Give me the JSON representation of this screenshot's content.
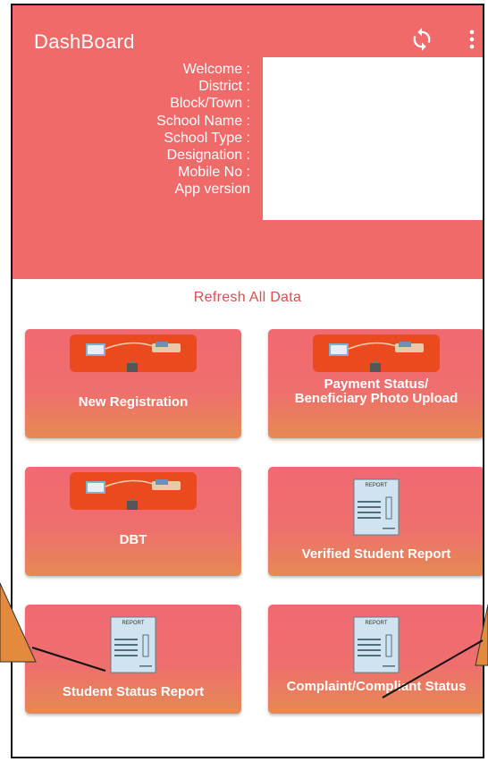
{
  "header": {
    "title": "DashBoard",
    "icons": [
      "sync-icon",
      "more-vert-icon"
    ],
    "fields": [
      "Welcome :",
      "District :",
      "Block/Town :",
      "School Name :",
      "School Type :",
      "Designation :",
      "Mobile No :",
      "App version"
    ]
  },
  "refresh_label": "Refresh All Data",
  "cards": [
    {
      "label": "New Registration",
      "icon": "money-transfer-icon"
    },
    {
      "label": "Payment Status/ Beneficiary Photo Upload",
      "icon": "money-transfer-icon"
    },
    {
      "label": "DBT",
      "icon": "money-transfer-icon"
    },
    {
      "label": "Verified Student Report",
      "icon": "report-icon"
    },
    {
      "label": "Student Status Report",
      "icon": "report-icon"
    },
    {
      "label": "Complaint/Compliant Status",
      "icon": "report-icon"
    }
  ],
  "report_icon_text": "REPORT",
  "colors": {
    "header": "#f06a6a",
    "accent_text": "#d94f4f",
    "callout": "#e48a3c"
  }
}
